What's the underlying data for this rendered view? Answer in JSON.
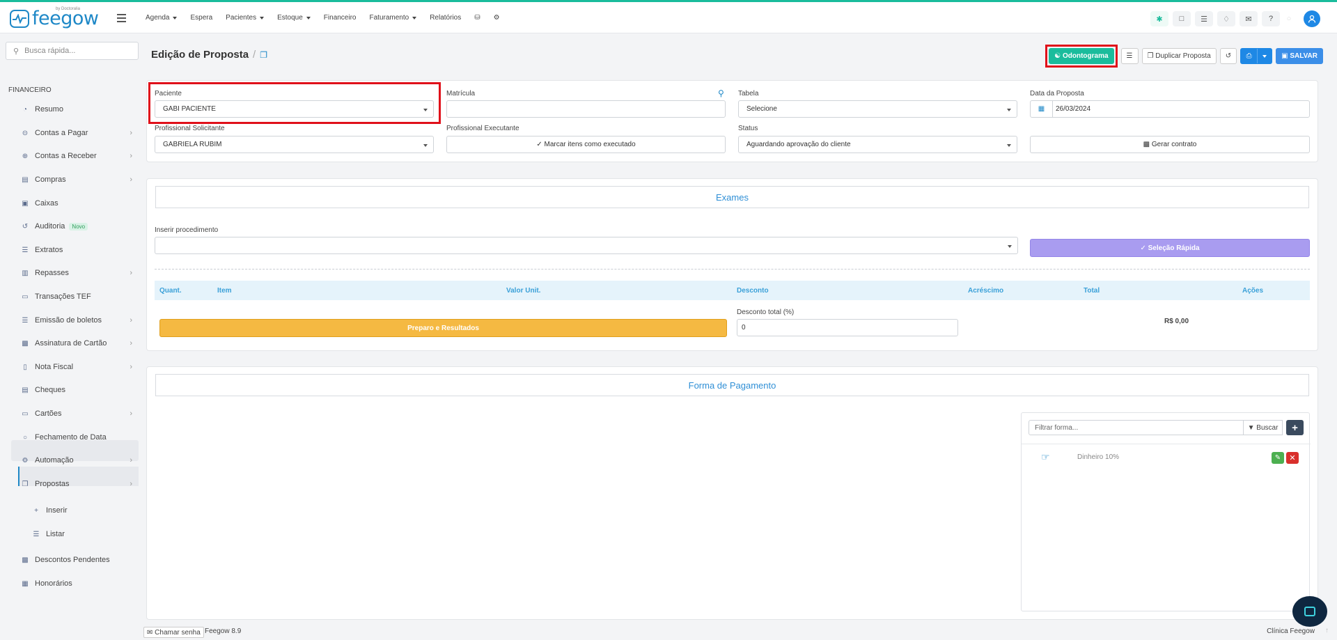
{
  "brand": {
    "name": "feegow",
    "by": "by Doctoralia",
    "color": "#1e88c7"
  },
  "topnav": [
    {
      "label": "Agenda",
      "dropdown": true
    },
    {
      "label": "Espera",
      "dropdown": false
    },
    {
      "label": "Pacientes",
      "dropdown": true
    },
    {
      "label": "Estoque",
      "dropdown": true
    },
    {
      "label": "Financeiro",
      "dropdown": false
    },
    {
      "label": "Faturamento",
      "dropdown": true
    },
    {
      "label": "Relatórios",
      "dropdown": false
    }
  ],
  "sidebar": {
    "search_placeholder": "Busca rápida...",
    "section": "FINANCEIRO",
    "items": [
      {
        "label": "Resumo",
        "icon": "chart-icon",
        "chevron": false
      },
      {
        "label": "Contas a Pagar",
        "icon": "minus-circle-icon",
        "chevron": true
      },
      {
        "label": "Contas a Receber",
        "icon": "plus-circle-icon",
        "chevron": true
      },
      {
        "label": "Compras",
        "icon": "cart-icon",
        "chevron": true
      },
      {
        "label": "Caixas",
        "icon": "inbox-icon",
        "chevron": false
      },
      {
        "label": "Auditoria",
        "icon": "history-icon",
        "chevron": false,
        "badge": "Novo"
      },
      {
        "label": "Extratos",
        "icon": "list-icon",
        "chevron": false
      },
      {
        "label": "Repasses",
        "icon": "hand-coins-icon",
        "chevron": true
      },
      {
        "label": "Transações TEF",
        "icon": "card-icon",
        "chevron": false
      },
      {
        "label": "Emissão de boletos",
        "icon": "barcode-icon",
        "chevron": true
      },
      {
        "label": "Assinatura de Cartão",
        "icon": "id-card-icon",
        "chevron": true
      },
      {
        "label": "Nota Fiscal",
        "icon": "file-icon",
        "chevron": true
      },
      {
        "label": "Cheques",
        "icon": "cheque-icon",
        "chevron": false
      },
      {
        "label": "Cartões",
        "icon": "credit-card-icon",
        "chevron": true
      },
      {
        "label": "Fechamento de Data",
        "icon": "lock-icon",
        "chevron": false
      },
      {
        "label": "Automação",
        "icon": "cogs-icon",
        "chevron": true
      },
      {
        "label": "Propostas",
        "icon": "copy-icon",
        "chevron": true
      }
    ],
    "sub_items": [
      {
        "label": "Inserir",
        "icon": "plus-icon"
      },
      {
        "label": "Listar",
        "icon": "list-icon"
      }
    ],
    "bottom_items": [
      {
        "label": "Descontos Pendentes",
        "icon": "money-icon"
      },
      {
        "label": "Honorários",
        "icon": "calendar-icon"
      }
    ]
  },
  "page": {
    "title": "Edição de Proposta"
  },
  "actions": {
    "odontograma": "Odontograma",
    "duplicar": "Duplicar Proposta",
    "salvar": "SALVAR"
  },
  "form": {
    "paciente": {
      "label": "Paciente",
      "value": "GABI PACIENTE"
    },
    "matricula": {
      "label": "Matrícula",
      "value": ""
    },
    "tabela": {
      "label": "Tabela",
      "value": "Selecione"
    },
    "data_proposta": {
      "label": "Data da Proposta",
      "value": "26/03/2024"
    },
    "prof_solicitante": {
      "label": "Profissional Solicitante",
      "value": "GABRIELA RUBIM"
    },
    "prof_executante": {
      "label": "Profissional Executante",
      "button": "Marcar itens como executado"
    },
    "status": {
      "label": "Status",
      "value": "Aguardando aprovação do cliente"
    },
    "gerar_contrato": "Gerar contrato"
  },
  "exames": {
    "title": "Exames",
    "inserir_label": "Inserir procedimento",
    "selecao_rapida": "Seleção Rápida",
    "columns": [
      "Quant.",
      "Item",
      "Valor Unit.",
      "Desconto",
      "Acréscimo",
      "Total",
      "Ações"
    ],
    "preparo_button": "Preparo e Resultados",
    "desconto_total_label": "Desconto total (%)",
    "desconto_total_value": "0",
    "total": "R$ 0,00"
  },
  "pagamento": {
    "title": "Forma de Pagamento",
    "filter_placeholder": "Filtrar forma...",
    "buscar": "Buscar",
    "rows": [
      {
        "label": "Dinheiro 10%"
      }
    ]
  },
  "footer": {
    "chamar_senha": "Chamar senha",
    "version": "Feegow 8.9",
    "clinic": "Clínica Feegow"
  },
  "colors": {
    "accent": "#1abc9c",
    "primary": "#1e88e5",
    "highlight": "#e0101a",
    "warning": "#f5b942",
    "purple": "#a99cf0"
  }
}
